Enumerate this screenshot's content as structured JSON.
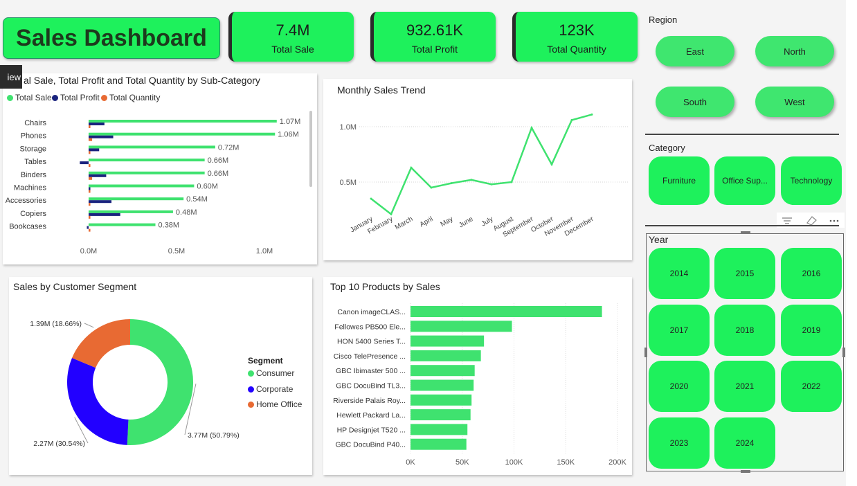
{
  "title": "Sales Dashboard",
  "kpis": [
    {
      "value": "7.4M",
      "label": "Total Sale"
    },
    {
      "value": "932.61K",
      "label": "Total Profit"
    },
    {
      "value": "123K",
      "label": "Total Quantity"
    }
  ],
  "tooltip": "iew",
  "colors": {
    "green": "#3fe26f",
    "navy": "#1a237e",
    "orange": "#e86a33",
    "blue": "#2200ff",
    "kpi": "#1ef15c"
  },
  "slicers": {
    "region": {
      "title": "Region",
      "items": [
        "East",
        "North",
        "South",
        "West"
      ]
    },
    "category": {
      "title": "Category",
      "items": [
        "Furniture",
        "Office Sup...",
        "Technology"
      ]
    },
    "year": {
      "title": "Year",
      "items": [
        "2014",
        "2015",
        "2016",
        "2017",
        "2018",
        "2019",
        "2020",
        "2021",
        "2022",
        "2023",
        "2024"
      ]
    }
  },
  "chart_data": [
    {
      "type": "bar",
      "title": "al Sale, Total Profit and Total Quantity by Sub-Category",
      "categories": [
        "Chairs",
        "Phones",
        "Storage",
        "Tables",
        "Binders",
        "Machines",
        "Accessories",
        "Copiers",
        "Bookcases"
      ],
      "series": [
        {
          "name": "Total Sale",
          "values": [
            1.07,
            1.06,
            0.72,
            0.66,
            0.66,
            0.6,
            0.54,
            0.48,
            0.38
          ]
        },
        {
          "name": "Total Profit",
          "values": [
            0.09,
            0.14,
            0.06,
            -0.05,
            0.1,
            0.01,
            0.13,
            0.18,
            -0.01
          ]
        },
        {
          "name": "Total Quantity",
          "values": [
            0.01,
            0.02,
            0.01,
            0.01,
            0.02,
            0.01,
            0.01,
            0.01,
            0.01
          ]
        }
      ],
      "data_labels": [
        "1.07M",
        "1.06M",
        "0.72M",
        "0.66M",
        "0.66M",
        "0.60M",
        "0.54M",
        "0.48M",
        "0.38M"
      ],
      "xticks": [
        "0.0M",
        "0.5M",
        "1.0M"
      ],
      "xlim": [
        0,
        1.1
      ],
      "orientation": "horizontal",
      "legend": "top-left"
    },
    {
      "type": "line",
      "title": "Monthly Sales Trend",
      "x": [
        "January",
        "February",
        "March",
        "April",
        "May",
        "June",
        "July",
        "August",
        "September",
        "October",
        "November",
        "December"
      ],
      "values": [
        0.35,
        0.21,
        0.63,
        0.45,
        0.49,
        0.52,
        0.48,
        0.5,
        0.99,
        0.66,
        1.06,
        1.11
      ],
      "yticks": [
        "1.0M",
        "0.5M"
      ],
      "ylim": [
        0.15,
        1.15
      ],
      "grid": true
    },
    {
      "type": "pie",
      "title": "Sales by Customer Segment",
      "legend_title": "Segment",
      "categories": [
        "Consumer",
        "Corporate",
        "Home Office"
      ],
      "values": [
        3.77,
        2.27,
        1.39
      ],
      "percent": [
        50.79,
        30.54,
        18.66
      ],
      "data_labels": [
        "3.77M (50.79%)",
        "2.27M (30.54%)",
        "1.39M (18.66%)"
      ],
      "colors": [
        "#3fe26f",
        "#2200ff",
        "#e86a33"
      ],
      "donut": true,
      "legend": "right"
    },
    {
      "type": "bar",
      "title": "Top 10 Products by Sales",
      "orientation": "horizontal",
      "categories": [
        "Canon imageCLAS...",
        "Fellowes PB500 Ele...",
        "HON 5400 Series T...",
        "Cisco TelePresence ...",
        "GBC Ibimaster 500 ...",
        "GBC DocuBind TL3...",
        "Riverside Palais Roy...",
        "Hewlett Packard La...",
        "HP Designjet T520 ...",
        "GBC DocuBind P40..."
      ],
      "values": [
        185000,
        98000,
        71000,
        68000,
        62000,
        61000,
        59000,
        58000,
        55000,
        54000
      ],
      "xticks": [
        "0K",
        "50K",
        "100K",
        "150K",
        "200K"
      ],
      "xlim": [
        0,
        200000
      ],
      "grid": true
    }
  ]
}
